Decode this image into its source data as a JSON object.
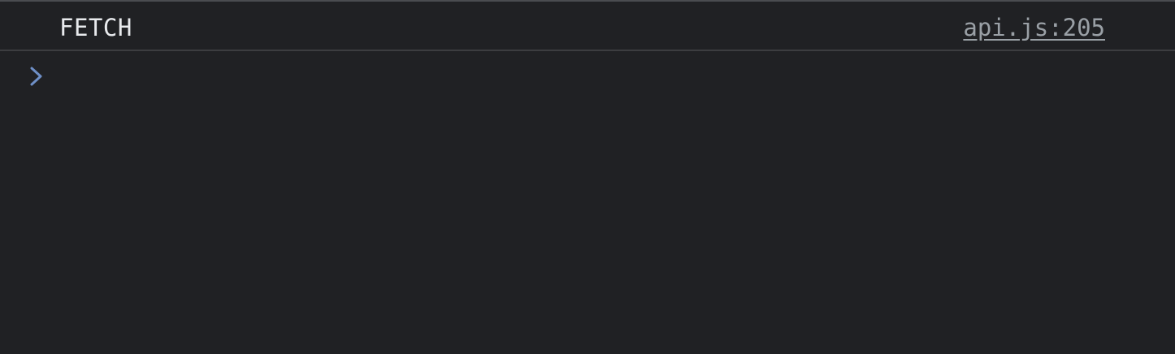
{
  "console": {
    "log_entry": {
      "message": "FETCH",
      "source": "api.js:205"
    },
    "prompt": {
      "icon": "chevron-right-icon",
      "icon_color": "#6e8fc7",
      "value": ""
    }
  },
  "colors": {
    "background": "#202124",
    "text": "#e8eaed",
    "link": "#9aa0a6",
    "divider": "#3c3d40"
  }
}
